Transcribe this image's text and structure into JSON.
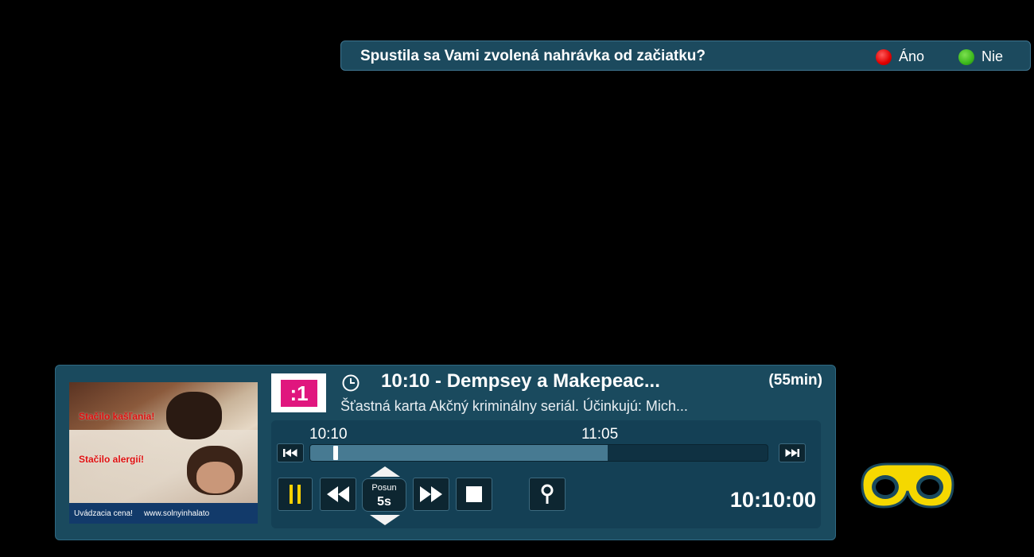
{
  "prompt": {
    "question": "Spustila sa Vami zvolená nahrávka od začiatku?",
    "yes_label": "Áno",
    "no_label": "Nie",
    "yes_color": "#e00000",
    "no_color": "#3cb81c"
  },
  "program": {
    "channel_logo_text": ":1",
    "channel_logo_icon": "jednotka-logo",
    "title": "10:10 - Dempsey a Makepeac...",
    "duration": "(55min)",
    "description": "Šťastná karta Akčný kriminálny seriál. Účinkujú: Mich...",
    "thumbnail": {
      "overlay_line1": "Stačilo kašľania!",
      "overlay_line2": "Stačilo alergií!",
      "ribbon_left": "Uvádzacia cena!",
      "ribbon_right": "www.solnyinhalato"
    }
  },
  "player": {
    "start_time": "10:10",
    "end_time": "11:05",
    "progress_fraction": 0.65,
    "playhead_fraction": 0.05,
    "seek_label": "Posun",
    "seek_value": "5s",
    "current_time": "10:10:00",
    "icons": {
      "skip_back": "skip-to-start-icon",
      "skip_forward": "skip-to-end-icon",
      "pause": "pause-icon",
      "rewind": "rewind-icon",
      "fast_forward": "fast-forward-icon",
      "stop": "stop-icon",
      "bookmark": "location-pin-icon"
    },
    "accent_color": "#ffd200"
  },
  "brand": {
    "icon": "binoculars-logo-icon",
    "color": "#f5d800"
  }
}
